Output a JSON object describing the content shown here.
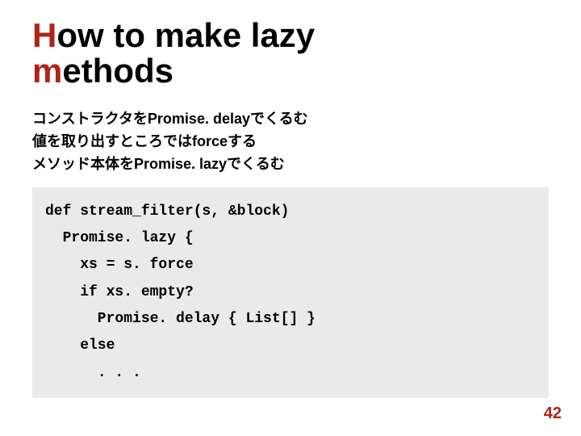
{
  "title": {
    "line1_first": "H",
    "line1_rest": "ow to make lazy",
    "line2_first": "m",
    "line2_rest": "ethods"
  },
  "bullets": [
    "コンストラクタをPromise. delayでくるむ",
    "値を取り出すところではforceする",
    "メソッド本体をPromise. lazyでくるむ"
  ],
  "code": {
    "l1": "def stream_filter(s, &block)",
    "l2": "  Promise. lazy {",
    "l3": "    xs = s. force",
    "l4": "    if xs. empty?",
    "l5": "      Promise. delay { List[] }",
    "l6": "    else",
    "l7": "      . . ."
  },
  "page_number": "42"
}
